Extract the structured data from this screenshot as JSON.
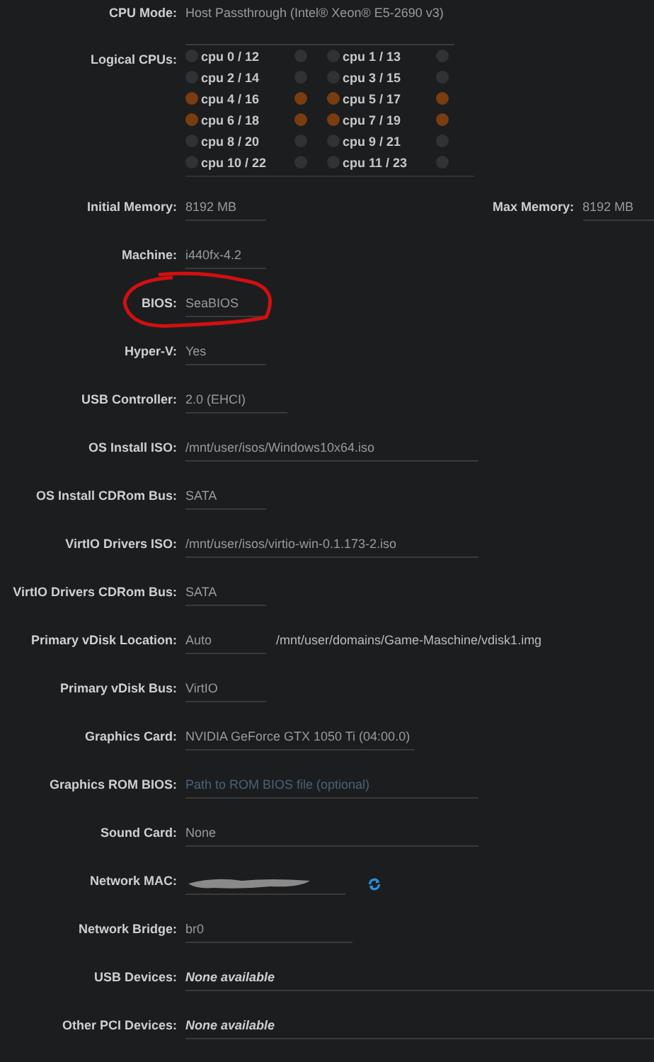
{
  "cpu_mode": {
    "label": "CPU Mode:",
    "value": "Host Passthrough (Intel® Xeon® E5-2690 v3)"
  },
  "logical_cpus": {
    "label": "Logical CPUs:",
    "cpus": [
      {
        "label": "cpu 0 / 12",
        "checked": false,
        "sibling_checked": false
      },
      {
        "label": "cpu 1 / 13",
        "checked": false,
        "sibling_checked": false
      },
      {
        "label": "cpu 2 / 14",
        "checked": false,
        "sibling_checked": false
      },
      {
        "label": "cpu 3 / 15",
        "checked": false,
        "sibling_checked": false
      },
      {
        "label": "cpu 4 / 16",
        "checked": true,
        "sibling_checked": true
      },
      {
        "label": "cpu 5 / 17",
        "checked": true,
        "sibling_checked": true
      },
      {
        "label": "cpu 6 / 18",
        "checked": true,
        "sibling_checked": true
      },
      {
        "label": "cpu 7 / 19",
        "checked": true,
        "sibling_checked": true
      },
      {
        "label": "cpu 8 / 20",
        "checked": false,
        "sibling_checked": false
      },
      {
        "label": "cpu 9 / 21",
        "checked": false,
        "sibling_checked": false
      },
      {
        "label": "cpu 10 / 22",
        "checked": false,
        "sibling_checked": false
      },
      {
        "label": "cpu 11 / 23",
        "checked": false,
        "sibling_checked": false
      }
    ]
  },
  "fields": [
    {
      "kind": "memory",
      "label": "Initial Memory:",
      "value": "8192 MB",
      "extra_label": "Max Memory:",
      "extra_value": "8192 MB"
    },
    {
      "kind": "short",
      "label": "Machine:",
      "value": "i440fx-4.2"
    },
    {
      "kind": "short",
      "label": "BIOS:",
      "value": "SeaBIOS",
      "circled": true
    },
    {
      "kind": "short",
      "label": "Hyper-V:",
      "value": "Yes"
    },
    {
      "kind": "medium",
      "label": "USB Controller:",
      "value": "2.0 (EHCI)"
    },
    {
      "kind": "long",
      "label": "OS Install ISO:",
      "value": "/mnt/user/isos/Windows10x64.iso"
    },
    {
      "kind": "short",
      "label": "OS Install CDRom Bus:",
      "value": "SATA"
    },
    {
      "kind": "long",
      "label": "VirtIO Drivers ISO:",
      "value": "/mnt/user/isos/virtio-win-0.1.173-2.iso"
    },
    {
      "kind": "short",
      "label": "VirtIO Drivers CDRom Bus:",
      "value": "SATA"
    },
    {
      "kind": "location",
      "label": "Primary vDisk Location:",
      "value": "Auto",
      "path": "/mnt/user/domains/Game-Maschine/vdisk1.img"
    },
    {
      "kind": "short",
      "label": "Primary vDisk Bus:",
      "value": "VirtIO"
    },
    {
      "kind": "graphics",
      "label": "Graphics Card:",
      "value": "NVIDIA GeForce GTX 1050 Ti (04:00.0)"
    },
    {
      "kind": "long",
      "label": "Graphics ROM BIOS:",
      "placeholder": "Path to ROM BIOS file (optional)"
    },
    {
      "kind": "long",
      "label": "Sound Card:",
      "value": "None"
    },
    {
      "kind": "mac",
      "label": "Network MAC:",
      "redacted": true
    },
    {
      "kind": "bridge",
      "label": "Network Bridge:",
      "value": "br0"
    },
    {
      "kind": "list",
      "label": "USB Devices:",
      "value": "None available"
    },
    {
      "kind": "list",
      "label": "Other PCI Devices:",
      "value": "None available"
    }
  ]
}
